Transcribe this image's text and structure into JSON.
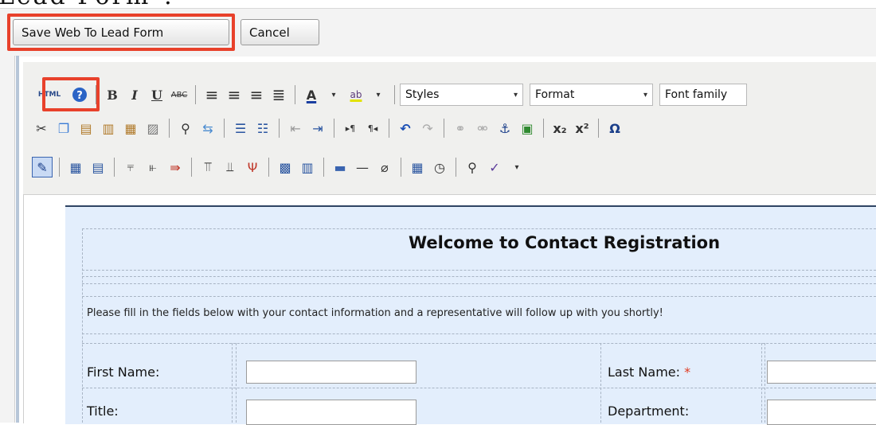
{
  "page": {
    "heading_fragment": "Lead Form\"."
  },
  "actions": {
    "save_label": "Save Web To Lead Form",
    "cancel_label": "Cancel"
  },
  "toolbar": {
    "html_label": "HTML",
    "styles_label": "Styles",
    "format_label": "Format",
    "font_family_label": "Font family",
    "row1_icons": [
      "html-icon",
      "help-icon",
      "bold-icon",
      "italic-icon",
      "underline-icon",
      "strikethrough-icon",
      "align-left-icon",
      "align-center-icon",
      "align-right-icon",
      "align-justify-icon",
      "font-color-icon",
      "highlight-color-icon"
    ],
    "row2_icons": [
      "cut-icon",
      "copy-icon",
      "paste-icon",
      "paste-text-icon",
      "paste-word-icon",
      "select-all-icon",
      "find-icon",
      "replace-icon",
      "bullet-list-icon",
      "numbered-list-icon",
      "outdent-icon",
      "indent-icon",
      "ltr-icon",
      "rtl-icon",
      "undo-icon",
      "redo-icon",
      "link-icon",
      "unlink-icon",
      "anchor-icon",
      "image-icon",
      "subscript-icon",
      "superscript-icon",
      "special-char-icon"
    ],
    "row3_icons": [
      "edit-source-icon",
      "table-icon",
      "table-props-icon",
      "insert-row-before-icon",
      "insert-row-after-icon",
      "delete-row-icon",
      "insert-col-before-icon",
      "insert-col-after-icon",
      "delete-col-icon",
      "merge-cells-icon",
      "split-cells-icon",
      "horizontal-rule-icon",
      "horizontal-line-icon",
      "eraser-icon",
      "insert-date-icon",
      "insert-time-icon",
      "preview-icon",
      "spellcheck-icon"
    ]
  },
  "form": {
    "title": "Welcome to Contact Registration",
    "message": "Please fill in the fields below with your contact information and a representative will follow up with you shortly!",
    "fields": [
      {
        "label": "First Name:",
        "required": false
      },
      {
        "label": "Last Name:",
        "required": true
      },
      {
        "label": "Title:",
        "required": false
      },
      {
        "label": "Department:",
        "required": false
      }
    ],
    "required_marker": "*"
  },
  "colors": {
    "highlight": "#e8412b",
    "required": "#e03b21",
    "content_bg": "#e3eefc"
  }
}
